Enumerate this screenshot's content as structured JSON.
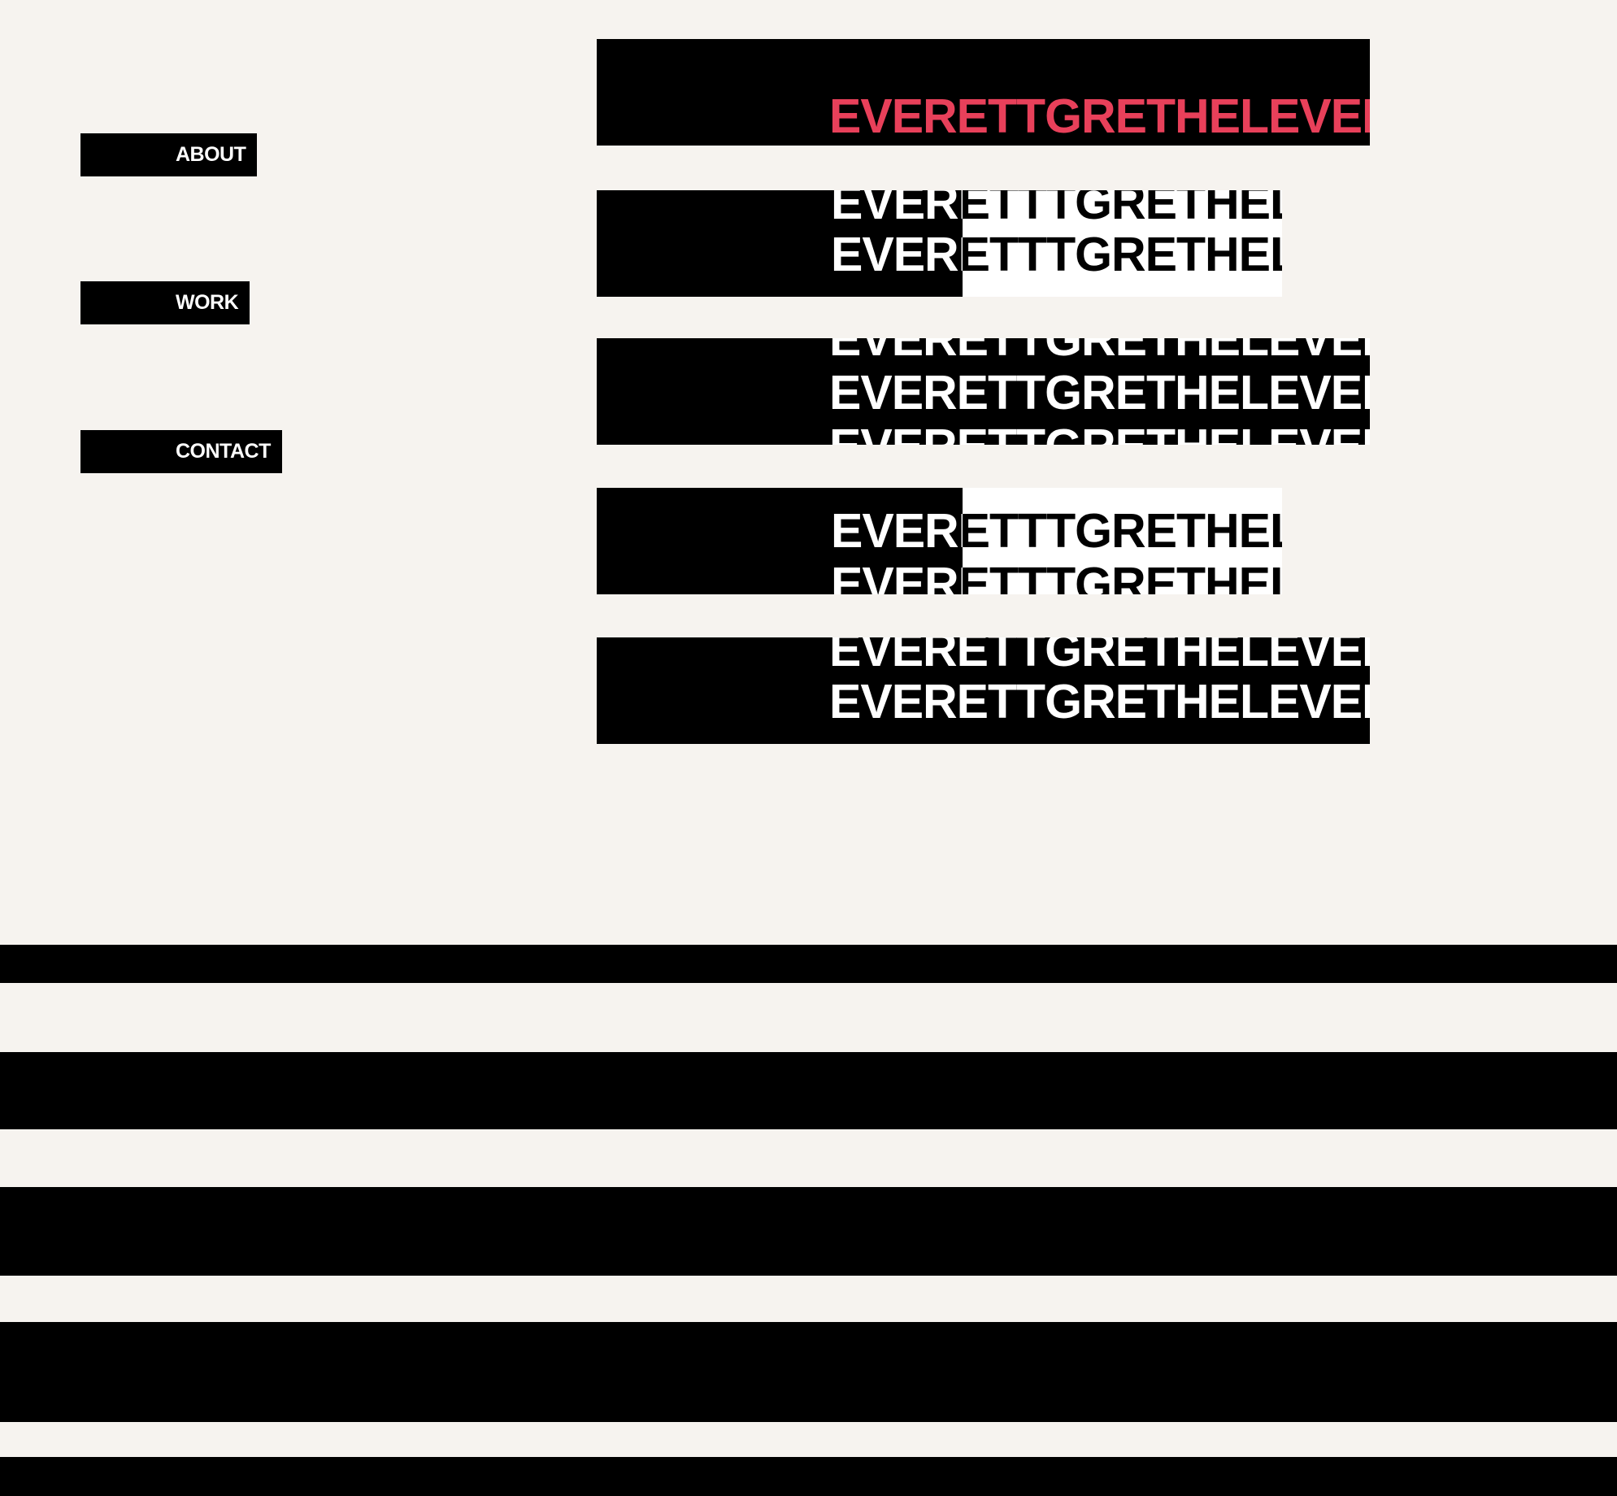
{
  "nav": {
    "about": "ABOUT",
    "work": "WORK",
    "contact": "CONTACT"
  },
  "marquee": {
    "long_text": "EVERETTGRETHELEVER",
    "short_text": "EVERETTTGRETHEL"
  },
  "colors": {
    "background": "#f6f3ef",
    "block": "#000000",
    "accent": "#e8405a",
    "inverted_fill": "#ffffff"
  }
}
